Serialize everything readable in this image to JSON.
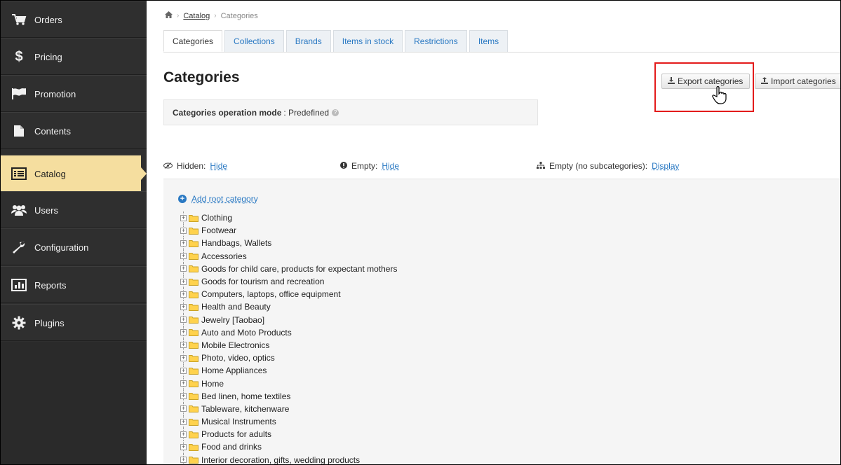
{
  "sidebar": {
    "items": [
      {
        "label": "Orders",
        "icon": "cart-icon"
      },
      {
        "label": "Pricing",
        "icon": "dollar-icon"
      },
      {
        "label": "Promotion",
        "icon": "flag-icon"
      },
      {
        "label": "Contents",
        "icon": "document-icon"
      },
      {
        "label": "Catalog",
        "icon": "list-icon",
        "active": true
      },
      {
        "label": "Users",
        "icon": "users-icon"
      },
      {
        "label": "Configuration",
        "icon": "wrench-icon"
      },
      {
        "label": "Reports",
        "icon": "bar-chart-icon"
      },
      {
        "label": "Plugins",
        "icon": "gear-icon"
      }
    ]
  },
  "breadcrumb": {
    "home_icon": "home-icon",
    "items": [
      "Catalog",
      "Categories"
    ]
  },
  "tabs": [
    "Categories",
    "Collections",
    "Brands",
    "Items in stock",
    "Restrictions",
    "Items"
  ],
  "active_tab": "Categories",
  "page": {
    "title": "Categories"
  },
  "actions": {
    "export_label": "Export categories",
    "import_label": "Import categories"
  },
  "mode": {
    "label": "Categories operation mode",
    "value": ": Predefined"
  },
  "filters": {
    "hidden": {
      "label": "Hidden:",
      "action": "Hide"
    },
    "empty": {
      "label": "Empty:",
      "action": "Hide"
    },
    "nosub": {
      "label": "Empty (no subcategories):",
      "action": "Display"
    }
  },
  "tree": {
    "add_root_label": "Add root category",
    "categories": [
      "Clothing",
      "Footwear",
      "Handbags, Wallets",
      "Accessories",
      "Goods for child care, products for expectant mothers",
      "Goods for tourism and recreation",
      "Computers, laptops, office equipment",
      "Health and Beauty",
      "Jewelry [Taobao]",
      "Auto and Moto Products",
      "Mobile Electronics",
      "Photo, video, optics",
      "Home Appliances",
      "Home",
      "Bed linen, home textiles",
      "Tableware, kitchenware",
      "Musical Instruments",
      "Products for adults",
      "Food and drinks",
      "Interior decoration, gifts, wedding products"
    ]
  },
  "colors": {
    "accent": "#2a79c3",
    "active_nav": "#f5de9f",
    "highlight": "#e31b1b",
    "sidebar": "#2f2f2f"
  }
}
